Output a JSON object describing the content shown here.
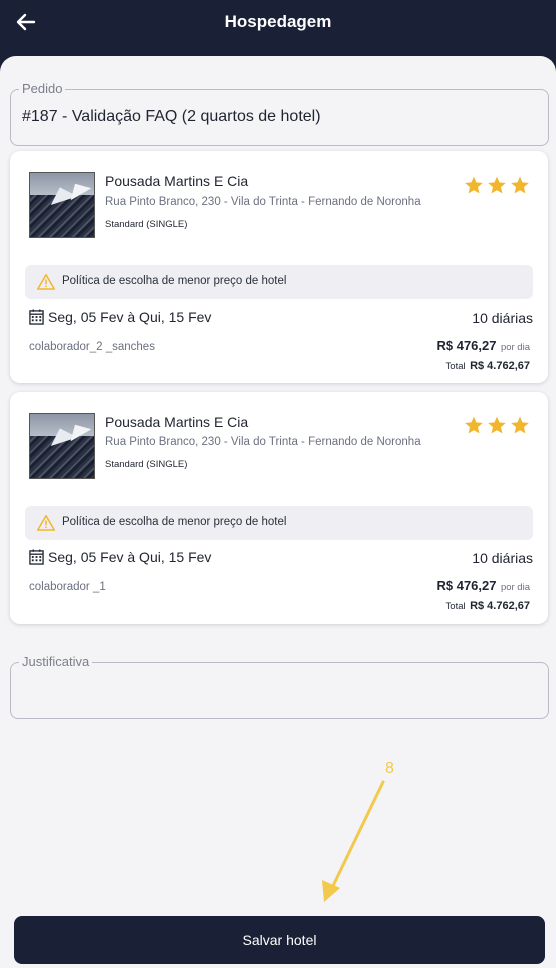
{
  "header": {
    "title": "Hospedagem",
    "back_icon": "arrow-left-icon"
  },
  "order": {
    "label": "Pedido",
    "value": "#187 - Validação FAQ (2 quartos de hotel)"
  },
  "bookings": [
    {
      "hotel_name": "Pousada Martins E Cia",
      "address": "Rua Pinto Branco, 230 - Vila do Trinta - Fernando de Noronha",
      "room": "Standard (SINGLE)",
      "stars": 3,
      "policy": "Política de escolha de menor preço de hotel",
      "dates": "Seg, 05 Fev à Qui, 15 Fev",
      "nights": "10 diárias",
      "collaborator": "colaborador_2 _sanches",
      "price_per_day": "R$ 476,27",
      "per_day_label": "por dia",
      "total_label": "Total",
      "total": "R$ 4.762,67"
    },
    {
      "hotel_name": "Pousada Martins E Cia",
      "address": "Rua Pinto Branco, 230 - Vila do Trinta - Fernando de Noronha",
      "room": "Standard (SINGLE)",
      "stars": 3,
      "policy": "Política de escolha de menor preço de hotel",
      "dates": "Seg, 05 Fev à Qui, 15 Fev",
      "nights": "10 diárias",
      "collaborator": "colaborador _1",
      "price_per_day": "R$ 476,27",
      "per_day_label": "por dia",
      "total_label": "Total",
      "total": "R$ 4.762,67"
    }
  ],
  "justification": {
    "label": "Justificativa",
    "value": ""
  },
  "annotation": {
    "number": "8"
  },
  "actions": {
    "save_label": "Salvar hotel"
  },
  "colors": {
    "navy": "#1a2035",
    "star": "#f2b62d",
    "warning": "#f2b62d",
    "annotation": "#f2c94c"
  }
}
